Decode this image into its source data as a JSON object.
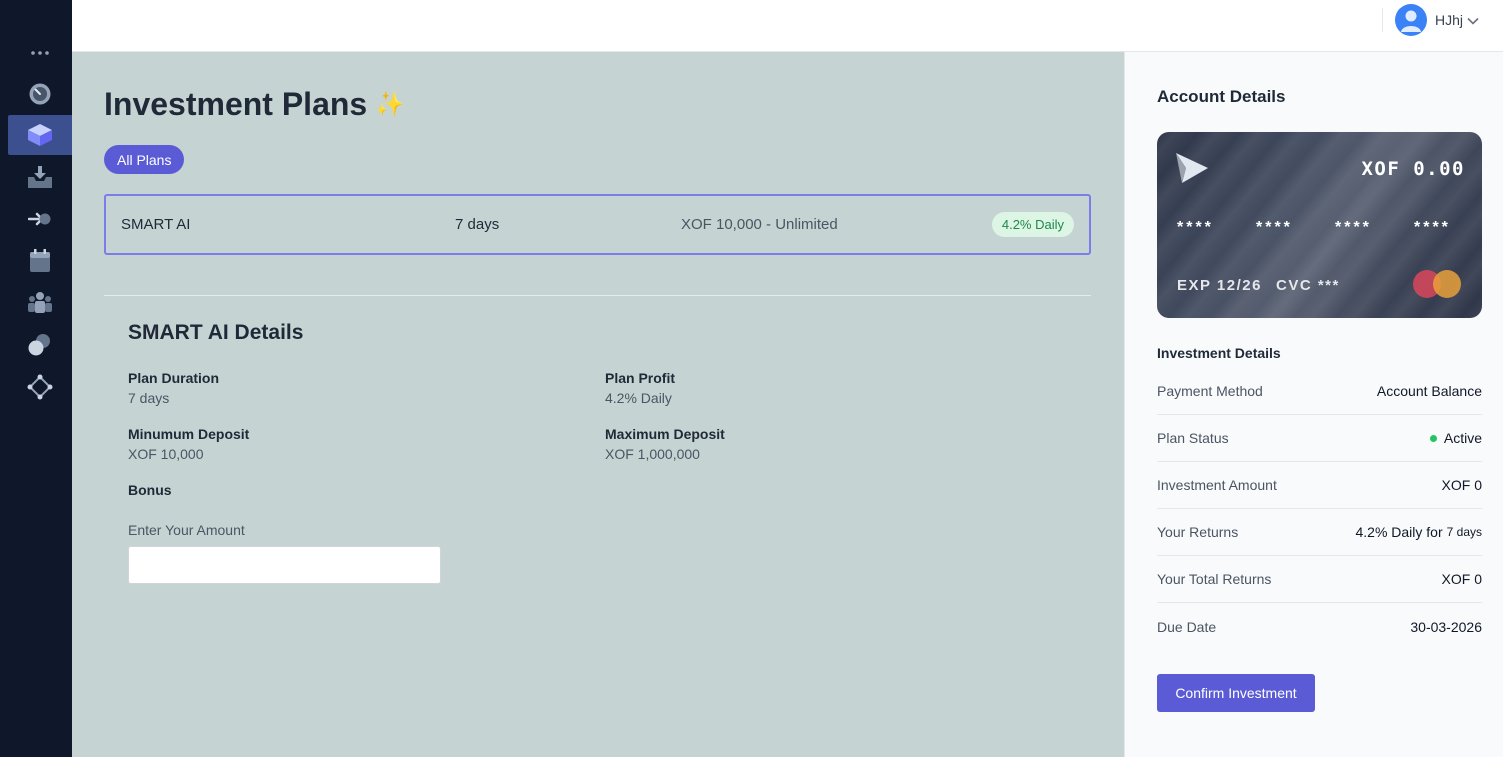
{
  "header": {
    "user_name": "HJhj"
  },
  "sidebar": {
    "items": [
      {
        "icon": "more-dots-icon"
      },
      {
        "icon": "dashboard-gauge-icon"
      },
      {
        "icon": "layers-icon"
      },
      {
        "icon": "inbox-download-icon"
      },
      {
        "icon": "sign-in-arrow-icon"
      },
      {
        "icon": "calendar-icon"
      },
      {
        "icon": "users-group-icon"
      },
      {
        "icon": "circles-icon"
      },
      {
        "icon": "network-nodes-icon"
      }
    ],
    "active_index": 2
  },
  "page": {
    "title": "Investment Plans",
    "title_emoji": "✨",
    "filter_label": "All Plans"
  },
  "plan": {
    "name": "SMART AI",
    "duration": "7 days",
    "range": "XOF 10,000 - Unlimited",
    "badge": "4.2% Daily",
    "badge_color": "#21874b"
  },
  "details": {
    "title": "SMART AI Details",
    "duration_label": "Plan Duration",
    "duration_value": "7 days",
    "profit_label": "Plan Profit",
    "profit_value": "4.2% Daily",
    "min_label": "Minumum Deposit",
    "min_value": "XOF 10,000",
    "max_label": "Maximum Deposit",
    "max_value": "XOF 1,000,000",
    "bonus_label": "Bonus",
    "amount_label": "Enter Your Amount",
    "amount_value": ""
  },
  "account": {
    "title": "Account Details",
    "card": {
      "balance": "XOF 0.00",
      "number_groups": [
        "****",
        "****",
        "****",
        "****"
      ],
      "expiry": "EXP 12/26",
      "cvc": "CVC ***"
    }
  },
  "investment": {
    "title": "Investment Details",
    "payment_method_label": "Payment Method",
    "payment_method_value": "Account Balance",
    "status_label": "Plan Status",
    "status_value": "Active",
    "status_color": "#22c55e",
    "amount_label": "Investment Amount",
    "amount_value": "XOF 0",
    "returns_label": "Your Returns",
    "returns_value": "4.2% Daily for",
    "returns_duration": "7 days",
    "total_label": "Your Total Returns",
    "total_value": "XOF 0",
    "due_label": "Due Date",
    "due_value": "30-03-2026"
  },
  "actions": {
    "confirm_label": "Confirm Investment"
  },
  "colors": {
    "accent": "#5b5bd6",
    "sidebar_bg": "#0f172a",
    "main_bg": "#c6d3d3"
  }
}
